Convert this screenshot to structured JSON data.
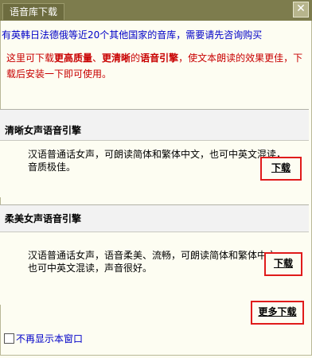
{
  "window": {
    "title": "语音库下载",
    "close_symbol": "✕"
  },
  "notice": "有英韩日法德俄等近20个其他国家的音库，需要请先咨询购买",
  "intro": {
    "part1": "这里可下载",
    "highlight1": "更高质量",
    "sep": "、",
    "highlight2": "更清晰",
    "part2": "的",
    "highlight3": "语音引擎",
    "part3": "，使文本朗读的效果更佳，下载后安装一下即可使用。"
  },
  "engines": [
    {
      "title": "清晰女声语音引擎",
      "description": "汉语普通话女声，可朗读简体和繁体中文，也可中英文混读，音质极佳。",
      "download_label": "下载"
    },
    {
      "title": "柔美女声语音引擎",
      "description": "汉语普通话女声，语音柔美、流畅，可朗读简体和繁体中文，也可中英文混读，声音很好。",
      "download_label": "下载"
    }
  ],
  "more_download_label": "更多下载",
  "checkbox": {
    "label": "不再显示本窗口",
    "checked": false
  },
  "colors": {
    "titlebar": "#7d7c4d",
    "notice_text": "#0000c8",
    "intro_text": "#c80000",
    "highlight_frame": "#e01b1b"
  }
}
